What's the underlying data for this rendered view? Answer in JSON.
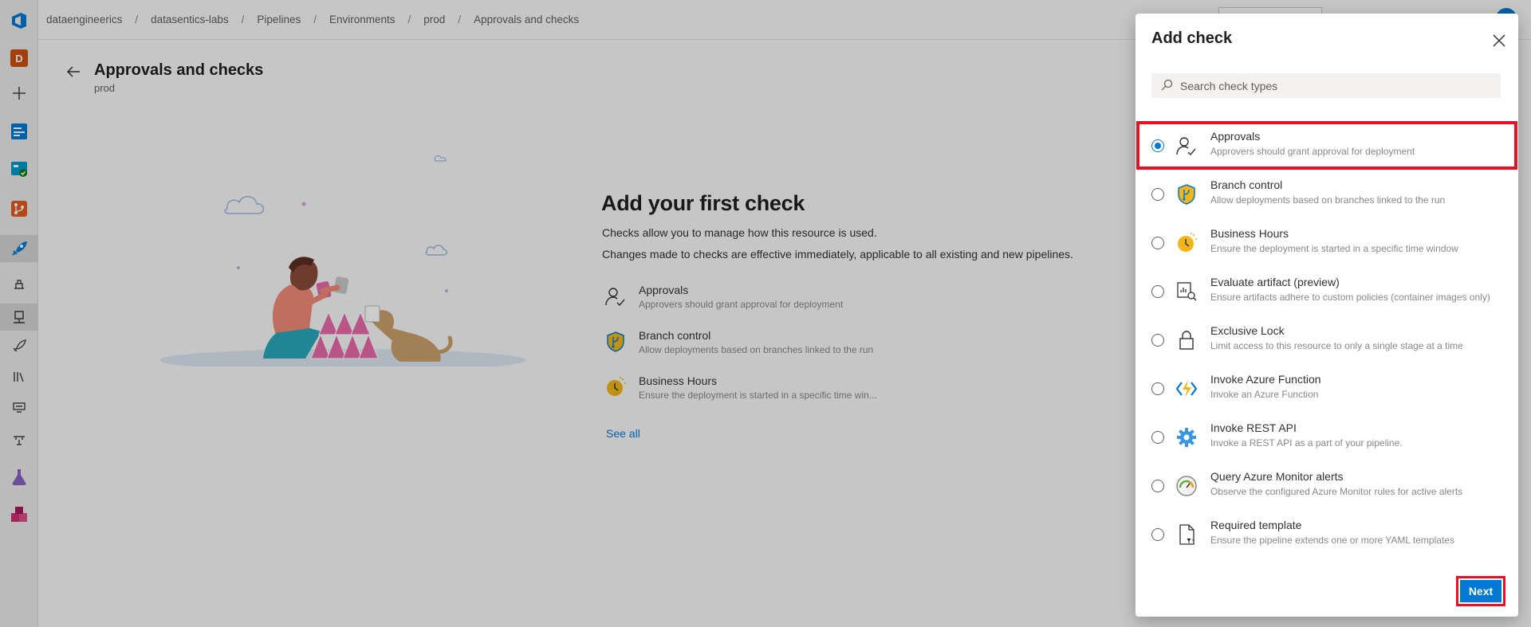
{
  "breadcrumb": [
    "dataengineerics",
    "datasentics-labs",
    "Pipelines",
    "Environments",
    "prod",
    "Approvals and checks"
  ],
  "page": {
    "title": "Approvals and checks",
    "subtitle": "prod"
  },
  "empty_state": {
    "title": "Add your first check",
    "line1": "Checks allow you to manage how this resource is used.",
    "line2": "Changes made to checks are effective immediately, applicable to all existing and new pipelines.",
    "checks": [
      {
        "title": "Approvals",
        "desc": "Approvers should grant approval for deployment",
        "icon": "person-check-icon"
      },
      {
        "title": "Branch control",
        "desc": "Allow deployments based on branches linked to the run",
        "icon": "shield-branch-icon"
      },
      {
        "title": "Business Hours",
        "desc": "Ensure the deployment is started in a specific time win...",
        "icon": "clock-sun-icon"
      }
    ],
    "see_all": "See all"
  },
  "panel": {
    "title": "Add check",
    "search_placeholder": "Search check types",
    "next_label": "Next",
    "options": [
      {
        "title": "Approvals",
        "desc": "Approvers should grant approval for deployment",
        "icon": "person-check-icon",
        "selected": true
      },
      {
        "title": "Branch control",
        "desc": "Allow deployments based on branches linked to the run",
        "icon": "shield-branch-icon",
        "selected": false
      },
      {
        "title": "Business Hours",
        "desc": "Ensure the deployment is started in a specific time window",
        "icon": "clock-sun-icon",
        "selected": false
      },
      {
        "title": "Evaluate artifact (preview)",
        "desc": "Ensure artifacts adhere to custom policies (container images only)",
        "icon": "artifact-search-icon",
        "selected": false
      },
      {
        "title": "Exclusive Lock",
        "desc": "Limit access to this resource to only a single stage at a time",
        "icon": "lock-icon",
        "selected": false
      },
      {
        "title": "Invoke Azure Function",
        "desc": "Invoke an Azure Function",
        "icon": "azure-function-icon",
        "selected": false
      },
      {
        "title": "Invoke REST API",
        "desc": "Invoke a REST API as a part of your pipeline.",
        "icon": "gear-icon",
        "selected": false
      },
      {
        "title": "Query Azure Monitor alerts",
        "desc": "Observe the configured Azure Monitor rules for active alerts",
        "icon": "gauge-icon",
        "selected": false
      },
      {
        "title": "Required template",
        "desc": "Ensure the pipeline extends one or more YAML templates",
        "icon": "yaml-template-icon",
        "selected": false
      }
    ]
  },
  "rail": {
    "project_initial": "D"
  },
  "colors": {
    "accent": "#0078d4",
    "highlight": "#e81123"
  }
}
